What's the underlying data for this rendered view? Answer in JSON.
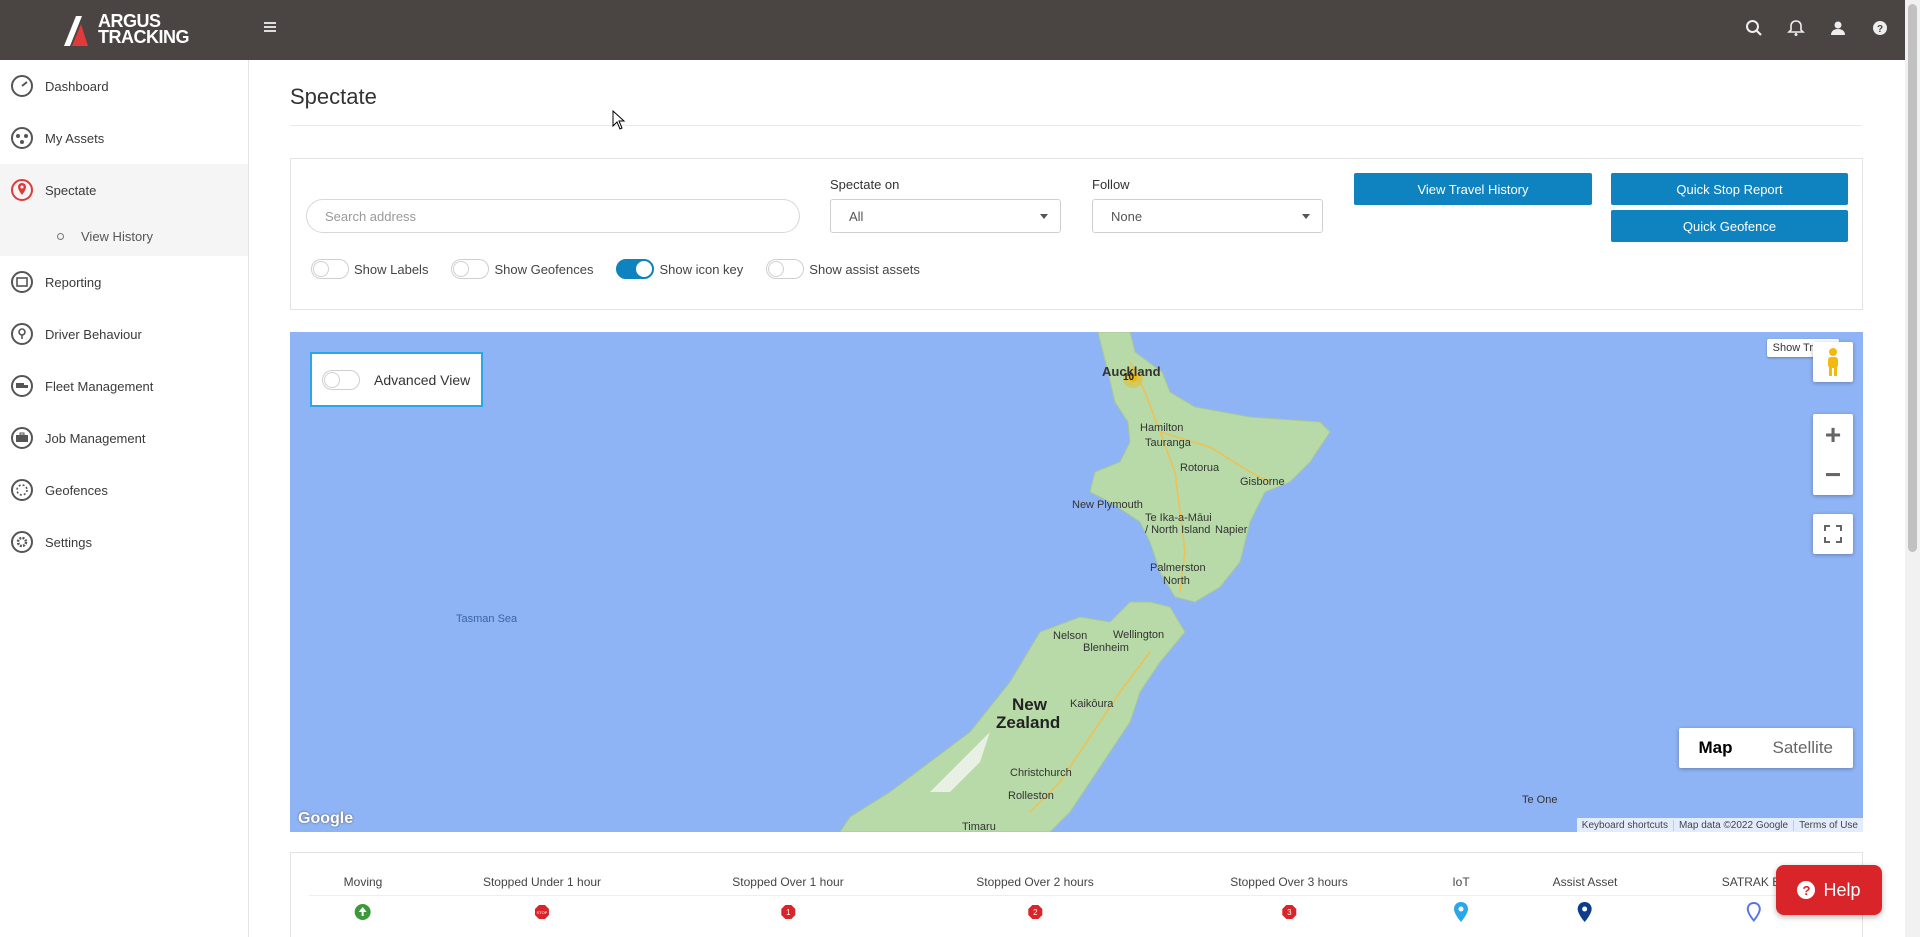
{
  "brand": {
    "line1": "ARGUS",
    "line2": "TRACKING",
    "accent": "#e03a3a"
  },
  "colors": {
    "topbar": "#4a4543",
    "primary": "#0f82c0",
    "map_water": "#8fb4f5",
    "help": "#d9242a"
  },
  "topbar_icons": [
    "search-icon",
    "bell-icon",
    "user-icon",
    "question-icon"
  ],
  "sidebar": {
    "items": [
      {
        "label": "Dashboard",
        "icon": "gauge-icon"
      },
      {
        "label": "My Assets",
        "icon": "assets-icon"
      },
      {
        "label": "Spectate",
        "icon": "map-pin-icon",
        "active": true
      },
      {
        "label": "Reporting",
        "icon": "report-icon"
      },
      {
        "label": "Driver Behaviour",
        "icon": "bulb-icon"
      },
      {
        "label": "Fleet Management",
        "icon": "truck-icon"
      },
      {
        "label": "Job Management",
        "icon": "briefcase-icon"
      },
      {
        "label": "Geofences",
        "icon": "geofence-icon"
      },
      {
        "label": "Settings",
        "icon": "gear-icon"
      }
    ],
    "subitem": "View History"
  },
  "page": {
    "title": "Spectate"
  },
  "controls": {
    "search_placeholder": "Search address",
    "spectate_on_label": "Spectate on",
    "spectate_on_value": "All",
    "follow_label": "Follow",
    "follow_value": "None",
    "btn_travel_history": "View Travel History",
    "btn_quick_stop": "Quick Stop Report",
    "btn_quick_geofence": "Quick Geofence"
  },
  "toggles": [
    {
      "label": "Show Labels",
      "on": false
    },
    {
      "label": "Show Geofences",
      "on": false
    },
    {
      "label": "Show icon key",
      "on": true
    },
    {
      "label": "Show assist assets",
      "on": false
    }
  ],
  "map": {
    "advanced_view": "Advanced View",
    "show_traffic": "Show Traffic",
    "zoom_in": "+",
    "zoom_out": "−",
    "type_map": "Map",
    "type_satellite": "Satellite",
    "cluster_count": "10",
    "google": "Google",
    "footer": [
      "Keyboard shortcuts",
      "Map data ©2022 Google",
      "Terms of Use"
    ],
    "places": {
      "auckland": "Auckland",
      "hamilton": "Hamilton",
      "tauranga": "Tauranga",
      "rotorua": "Rotorua",
      "gisborne": "Gisborne",
      "new_plymouth": "New Plymouth",
      "te_ika": "Te Ika-a-Māui",
      "north_island": "/ North Island",
      "napier": "Napier",
      "palmerston": "Palmerston",
      "north": "North",
      "nelson": "Nelson",
      "blenheim": "Blenheim",
      "wellington": "Wellington",
      "kaikoura": "Kaikōura",
      "new": "New",
      "zealand": "Zealand",
      "christchurch": "Christchurch",
      "rolleston": "Rolleston",
      "te_one": "Te One",
      "timaru": "Timaru",
      "tasman_sea": "Tasman Sea"
    }
  },
  "legend": [
    {
      "label": "Moving",
      "icon": "arrow-up-green-icon"
    },
    {
      "label": "Stopped Under 1 hour",
      "icon": "stop-sign-icon"
    },
    {
      "label": "Stopped Over 1 hour",
      "icon": "stop-1-icon",
      "num": "1"
    },
    {
      "label": "Stopped Over 2 hours",
      "icon": "stop-2-icon",
      "num": "2"
    },
    {
      "label": "Stopped Over 3 hours",
      "icon": "stop-3-icon",
      "num": "3"
    },
    {
      "label": "IoT",
      "icon": "iot-pin-icon"
    },
    {
      "label": "Assist Asset",
      "icon": "assist-pin-icon"
    },
    {
      "label": "SATRAK Ev",
      "icon": "satrak-pin-icon"
    }
  ],
  "help": {
    "label": "Help"
  }
}
